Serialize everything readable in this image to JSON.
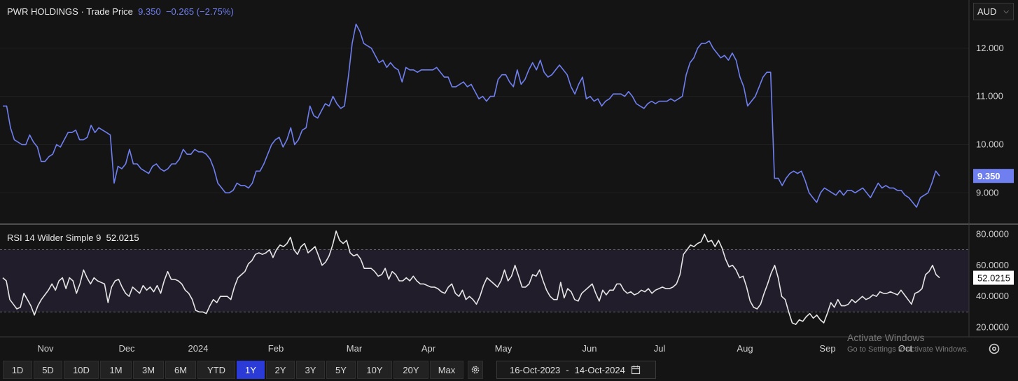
{
  "header": {
    "symbol": "PWR HOLDINGS",
    "separator": "·",
    "field": "Trade Price",
    "last": "9.350",
    "change": "−0.265 (−2.75%)"
  },
  "currency": {
    "label": "AUD"
  },
  "rsi_header": {
    "label": "RSI 14 Wilder Simple 9",
    "value": "52.0215"
  },
  "watermark": {
    "line1": "Activate Windows",
    "line2": "Go to Settings to activate Windows."
  },
  "toolbar": {
    "ranges": [
      "1D",
      "5D",
      "10D",
      "1M",
      "3M",
      "6M",
      "YTD",
      "1Y",
      "2Y",
      "3Y",
      "5Y",
      "10Y",
      "20Y",
      "Max"
    ],
    "active": "1Y",
    "date_from": "16-Oct-2023",
    "date_sep": "-",
    "date_to": "14-Oct-2024"
  },
  "colors": {
    "price_line": "#6f7ff0",
    "rsi_line": "#e6e6e6",
    "band_fill": "#211d2b",
    "background": "#141414",
    "active_range": "#2a3bd8"
  },
  "icons": {
    "range_settings": "gear-icon",
    "calendar": "calendar-icon",
    "chart_settings": "settings-icon",
    "dropdown": "chevron-down-icon"
  },
  "chart_data": [
    {
      "type": "line",
      "name": "price",
      "x_axis": {
        "ticks": [
          "Nov",
          "Dec",
          "2024",
          "Feb",
          "Mar",
          "Apr",
          "May",
          "Jun",
          "Jul",
          "Aug",
          "Sep",
          "Oct"
        ]
      },
      "y_axis": {
        "ticks": [
          "9.000",
          "10.000",
          "11.000",
          "12.000"
        ],
        "range": [
          8.35,
          13.0
        ]
      },
      "last_value_label": "9.350",
      "series": [
        {
          "values": [
            10.8,
            10.8,
            10.35,
            10.1,
            10.05,
            10.0,
            10.0,
            10.2,
            10.05,
            9.95,
            9.65,
            9.65,
            9.75,
            9.8,
            10.0,
            9.95,
            10.1,
            10.25,
            10.25,
            10.3,
            10.1,
            10.1,
            10.15,
            10.4,
            10.25,
            10.35,
            10.3,
            10.25,
            10.2,
            9.2,
            9.55,
            9.5,
            9.6,
            9.9,
            9.6,
            9.6,
            9.5,
            9.45,
            9.4,
            9.55,
            9.6,
            9.5,
            9.45,
            9.5,
            9.6,
            9.6,
            9.7,
            9.9,
            9.8,
            9.8,
            9.9,
            9.85,
            9.85,
            9.8,
            9.7,
            9.5,
            9.2,
            9.1,
            9.0,
            9.0,
            9.05,
            9.2,
            9.15,
            9.15,
            9.1,
            9.2,
            9.45,
            9.45,
            9.6,
            9.8,
            10.0,
            10.1,
            10.15,
            9.95,
            10.1,
            10.35,
            10.0,
            10.1,
            10.3,
            10.35,
            10.8,
            10.6,
            10.55,
            10.7,
            10.85,
            10.8,
            11.0,
            10.85,
            10.75,
            10.8,
            11.4,
            12.1,
            12.5,
            12.35,
            12.1,
            12.05,
            12.0,
            11.85,
            11.7,
            11.75,
            11.6,
            11.7,
            11.6,
            11.55,
            11.3,
            11.6,
            11.55,
            11.55,
            11.5,
            11.55,
            11.55,
            11.55,
            11.55,
            11.6,
            11.5,
            11.4,
            11.4,
            11.2,
            11.2,
            11.25,
            11.3,
            11.2,
            11.25,
            11.1,
            10.95,
            11.0,
            10.9,
            11.0,
            11.0,
            11.35,
            11.45,
            11.45,
            11.3,
            11.2,
            11.55,
            11.25,
            11.35,
            11.55,
            11.7,
            11.55,
            11.75,
            11.5,
            11.4,
            11.45,
            11.55,
            11.65,
            11.55,
            11.45,
            11.2,
            11.05,
            11.25,
            11.4,
            10.95,
            11.0,
            10.9,
            10.95,
            10.8,
            10.9,
            10.95,
            11.05,
            11.05,
            11.05,
            11.0,
            11.1,
            11.0,
            10.85,
            10.8,
            10.75,
            10.85,
            10.9,
            10.85,
            10.9,
            10.9,
            10.9,
            10.95,
            10.9,
            10.95,
            11.0,
            11.45,
            11.7,
            11.8,
            12.0,
            12.1,
            12.1,
            12.15,
            12.0,
            11.9,
            11.8,
            11.85,
            11.75,
            11.9,
            11.75,
            11.4,
            11.2,
            10.8,
            10.9,
            11.0,
            11.2,
            11.4,
            11.5,
            11.5,
            9.3,
            9.3,
            9.15,
            9.3,
            9.4,
            9.45,
            9.4,
            9.45,
            9.25,
            9.0,
            8.9,
            8.8,
            9.0,
            9.1,
            9.05,
            9.0,
            8.95,
            9.05,
            8.95,
            9.05,
            9.05,
            9.0,
            9.05,
            9.1,
            9.0,
            8.9,
            9.05,
            9.2,
            9.1,
            9.15,
            9.1,
            9.1,
            9.05,
            9.05,
            8.95,
            8.9,
            8.8,
            8.7,
            8.9,
            8.95,
            9.0,
            9.2,
            9.45,
            9.35
          ]
        }
      ]
    },
    {
      "type": "line",
      "name": "rsi",
      "y_axis": {
        "ticks": [
          "20.0000",
          "40.0000",
          "60.0000",
          "80.0000"
        ],
        "range": [
          14,
          86
        ]
      },
      "bands": [
        30,
        70
      ],
      "last_value_label": "52.0215",
      "series": [
        {
          "values": [
            52,
            50,
            38,
            35,
            32,
            33,
            42,
            38,
            34,
            28,
            34,
            38,
            41,
            44,
            48,
            44,
            50,
            52,
            45,
            52,
            50,
            42,
            48,
            57,
            52,
            48,
            52,
            50,
            49,
            48,
            36,
            46,
            50,
            51,
            46,
            42,
            40,
            46,
            44,
            42,
            47,
            44,
            46,
            43,
            47,
            42,
            50,
            56,
            51,
            51,
            50,
            48,
            44,
            42,
            38,
            31,
            30,
            30,
            29,
            34,
            38,
            36,
            40,
            40,
            40,
            38,
            46,
            52,
            54,
            56,
            61,
            63,
            67,
            68,
            67,
            68,
            70,
            65,
            70,
            73,
            72,
            74,
            78,
            70,
            67,
            72,
            74,
            68,
            70,
            72,
            66,
            60,
            62,
            66,
            73,
            82,
            76,
            74,
            76,
            68,
            66,
            67,
            64,
            58,
            58,
            58,
            56,
            53,
            54,
            58,
            51,
            56,
            54,
            50,
            50,
            52,
            50,
            53,
            50,
            48,
            48,
            47,
            46,
            46,
            45,
            43,
            42,
            46,
            48,
            42,
            40,
            44,
            38,
            40,
            38,
            35,
            40,
            47,
            52,
            50,
            48,
            46,
            50,
            57,
            50,
            53,
            60,
            53,
            46,
            46,
            48,
            54,
            53,
            57,
            50,
            44,
            40,
            38,
            38,
            49,
            39,
            45,
            43,
            38,
            37,
            42,
            44,
            46,
            48,
            42,
            37,
            44,
            41,
            44,
            44,
            48,
            48,
            44,
            42,
            43,
            41,
            42,
            44,
            43,
            45,
            42,
            44,
            45,
            46,
            45,
            45,
            46,
            48,
            54,
            67,
            70,
            73,
            72,
            74,
            75,
            80,
            75,
            76,
            72,
            76,
            71,
            64,
            59,
            60,
            57,
            52,
            53,
            46,
            37,
            33,
            32,
            35,
            42,
            48,
            55,
            60,
            52,
            40,
            38,
            30,
            23,
            22,
            25,
            24,
            27,
            29,
            26,
            28,
            25,
            23,
            29,
            36,
            33,
            38,
            34,
            34,
            35,
            38,
            36,
            38,
            40,
            38,
            39,
            41,
            40,
            43,
            42,
            42,
            43,
            42,
            41,
            44,
            41,
            38,
            35,
            42,
            43,
            45,
            54,
            56,
            60,
            54,
            52
          ]
        }
      ]
    }
  ]
}
